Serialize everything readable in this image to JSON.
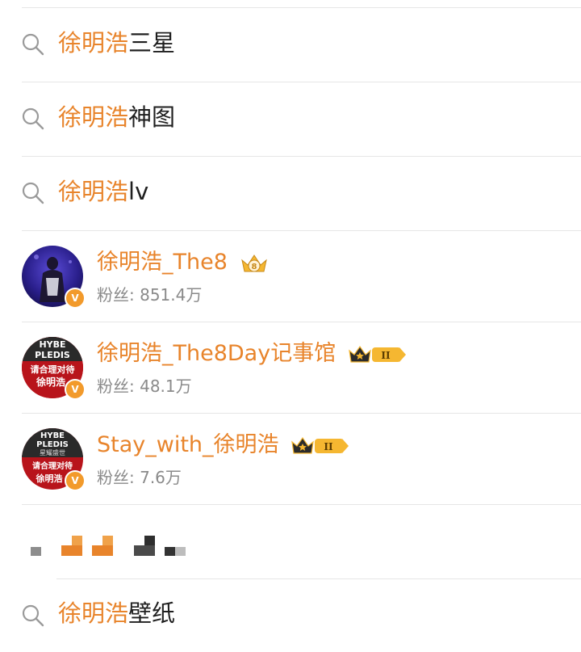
{
  "suggestions": [
    {
      "highlight": "徐明浩",
      "rest": "三星"
    },
    {
      "highlight": "徐明浩",
      "rest": "神图"
    },
    {
      "highlight": "徐明浩",
      "rest": "lv"
    }
  ],
  "users": [
    {
      "name": "徐明浩_The8",
      "fans": "粉丝: 851.4万",
      "badge": "V",
      "crown_level": "8"
    },
    {
      "name": "徐明浩_The8Day记事馆",
      "fans": "粉丝: 48.1万",
      "badge": "V",
      "crown_level": "II",
      "avatar_lines": [
        "HYBE",
        "PLEDIS",
        "请合理对待",
        "徐明浩"
      ]
    },
    {
      "name": "Stay_with_徐明浩",
      "fans": "粉丝: 7.6万",
      "badge": "V",
      "crown_level": "II",
      "avatar_lines": [
        "HYBE",
        "PLEDIS",
        "星耀盛世",
        "请合理对待",
        "徐明浩"
      ]
    }
  ],
  "bottom_suggestion": {
    "highlight": "徐明浩",
    "rest": "壁纸"
  },
  "colors": {
    "highlight": "#e8842b",
    "text": "#1f1f1f",
    "secondary": "#8a8a8a",
    "separator": "#e6e6e6",
    "vip_gold": "#f5b731",
    "avatar_red": "#b8141b"
  },
  "icons": [
    "search-icon",
    "verified-badge-icon",
    "crown-icon"
  ]
}
